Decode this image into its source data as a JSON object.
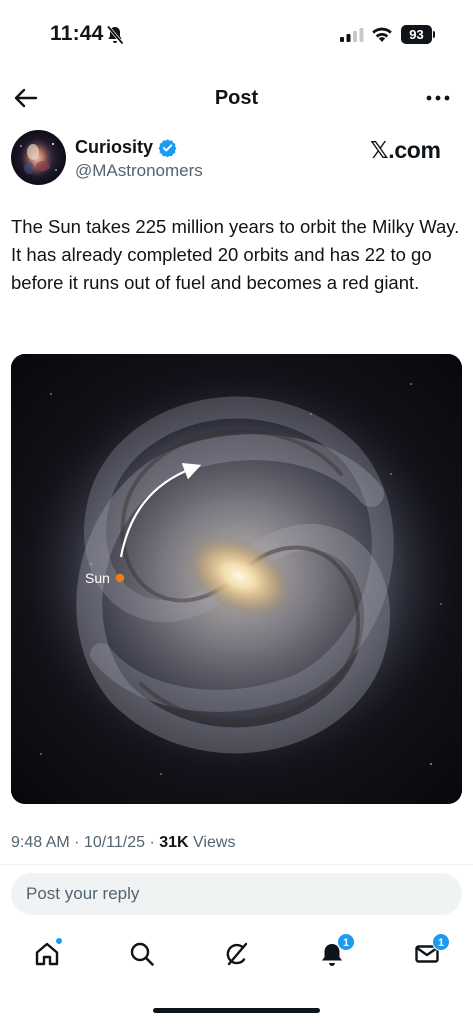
{
  "status_bar": {
    "time": "11:44",
    "battery": "93",
    "icons": [
      "bell-slash-icon",
      "signal-icon",
      "wifi-icon",
      "battery-icon"
    ]
  },
  "nav": {
    "title": "Post",
    "back_icon": "arrow-left-icon",
    "more_icon": "more-horizontal-icon"
  },
  "author": {
    "name": "Curiosity",
    "handle": "@MAstronomers",
    "verified": true,
    "source": "𝕏.com"
  },
  "post": {
    "text": "The Sun takes 225 million years to orbit the Milky Way. It has already completed 20 orbits and has 22 to go before it runs out of fuel and becomes a red giant.",
    "image": {
      "label": "Sun",
      "marker_color": "#f07c1a"
    }
  },
  "meta": {
    "time": "9:48 AM",
    "date": "10/11/25",
    "views_count": "31K",
    "views_label": "Views"
  },
  "reply": {
    "placeholder": "Post your reply"
  },
  "tabs": [
    {
      "name": "home",
      "icon": "home-icon",
      "dot": true
    },
    {
      "name": "search",
      "icon": "search-icon"
    },
    {
      "name": "grok",
      "icon": "grok-icon"
    },
    {
      "name": "notifications",
      "icon": "bell-icon",
      "badge": "1"
    },
    {
      "name": "messages",
      "icon": "mail-icon",
      "badge": "1"
    }
  ],
  "colors": {
    "accent": "#1d9bf0",
    "text": "#0f1419",
    "secondary": "#536471"
  }
}
